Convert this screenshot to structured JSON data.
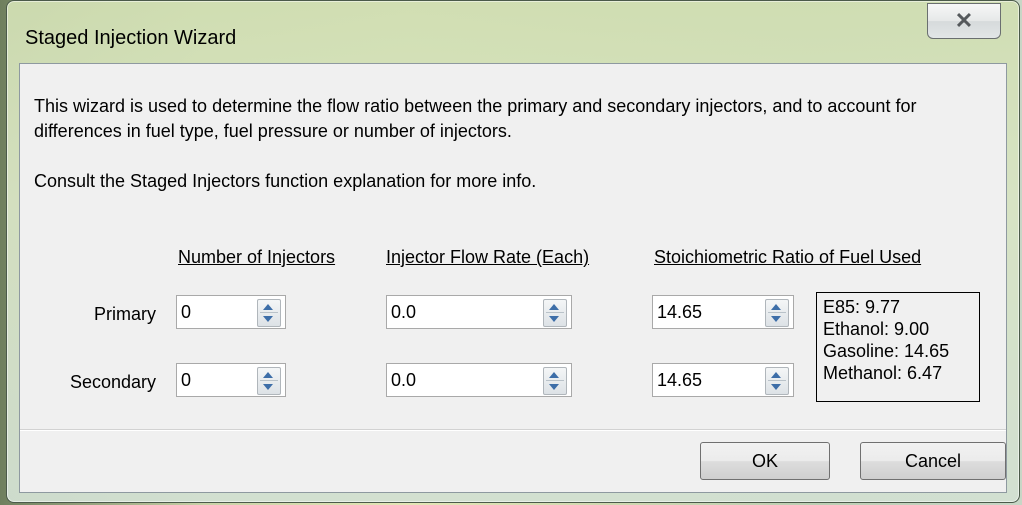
{
  "window": {
    "title": "Staged Injection Wizard",
    "close_symbol": "✕"
  },
  "description": {
    "line1": "This wizard is used to determine the flow ratio between the primary and secondary injectors, and to account for differences in fuel type, fuel pressure or number of injectors.",
    "line2": "Consult the Staged Injectors function explanation for more info."
  },
  "columns": {
    "num_injectors": "Number of Injectors",
    "flow_rate": "Injector Flow Rate (Each)",
    "stoich": "Stoichiometric Ratio of Fuel Used"
  },
  "rows": {
    "primary": {
      "label": "Primary",
      "num_injectors": "0",
      "flow_rate": "0.0",
      "stoich": "14.65"
    },
    "secondary": {
      "label": "Secondary",
      "num_injectors": "0",
      "flow_rate": "0.0",
      "stoich": "14.65"
    }
  },
  "fuel_reference": [
    "E85: 9.77",
    "Ethanol: 9.00",
    "Gasoline: 14.65",
    "Methanol: 6.47"
  ],
  "buttons": {
    "ok": "OK",
    "cancel": "Cancel"
  }
}
